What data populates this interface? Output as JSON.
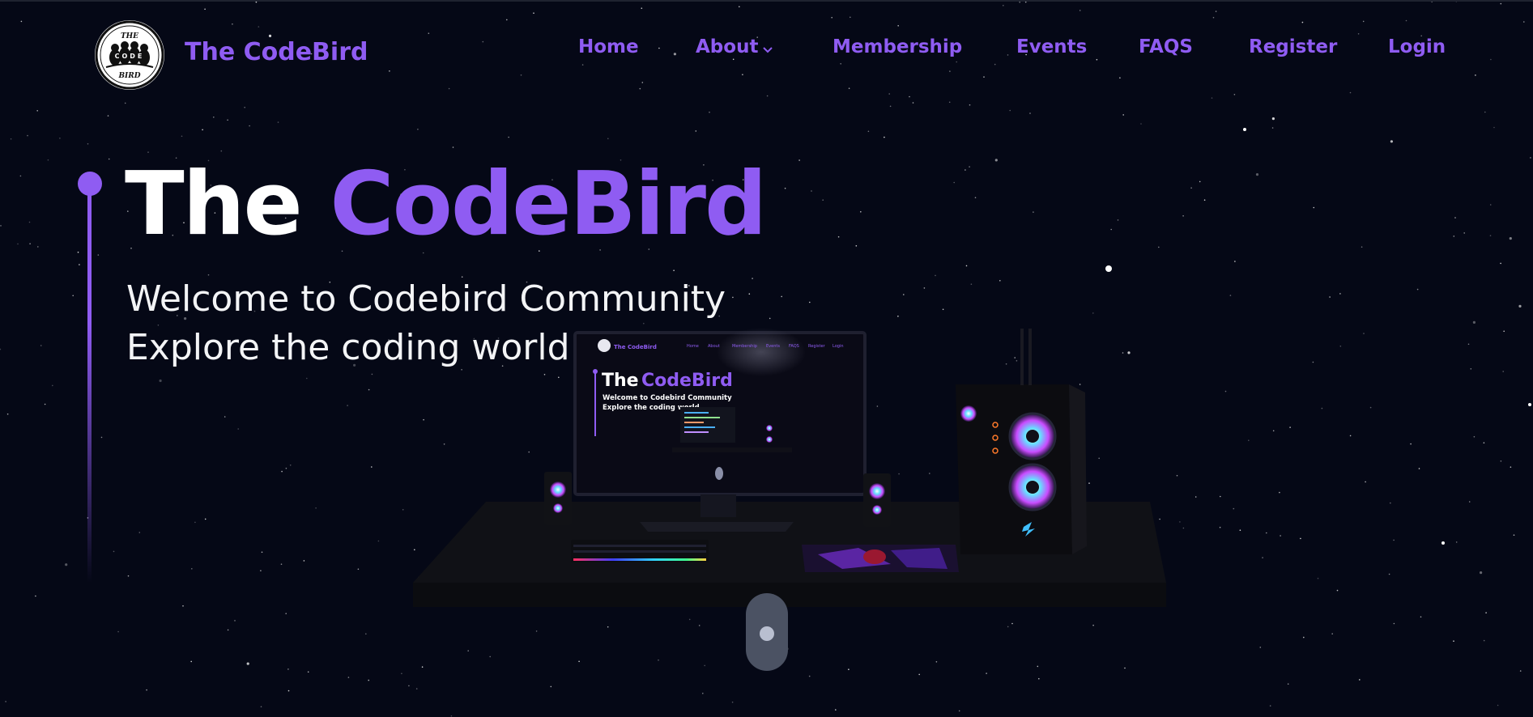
{
  "brand": {
    "name": "The CodeBird",
    "logo_icon": "codebird-birds-logo-icon",
    "logo_text_top": "THE",
    "logo_text_middle": "CODE",
    "logo_text_bottom": "BIRD"
  },
  "nav": {
    "items": [
      {
        "label": "Home"
      },
      {
        "label": "About",
        "has_dropdown": true,
        "icon": "chevron-down-icon"
      },
      {
        "label": "Membership"
      },
      {
        "label": "Events"
      },
      {
        "label": "FAQS"
      },
      {
        "label": "Register"
      },
      {
        "label": "Login"
      }
    ]
  },
  "hero": {
    "title_white": "The",
    "title_accent": "CodeBird",
    "subtitle_line1": "Welcome to Codebird Community",
    "subtitle_line2": "Explore the coding world",
    "scene_icon": "desk-computer-setup-3d-icon"
  },
  "screen_preview": {
    "brand": "The CodeBird",
    "nav": [
      "Home",
      "About",
      "Membership",
      "Events",
      "FAQS",
      "Register",
      "Login"
    ],
    "title_white": "The",
    "title_accent": "CodeBird",
    "subtitle_line1": "Welcome to Codebird Community",
    "subtitle_line2": "Explore the coding world"
  },
  "scroll": {
    "icon": "scroll-indicator-icon"
  },
  "colors": {
    "accent": "#8f5cf2",
    "background": "#050816",
    "text": "#ffffff",
    "scroll_pill": "#4b5263"
  }
}
